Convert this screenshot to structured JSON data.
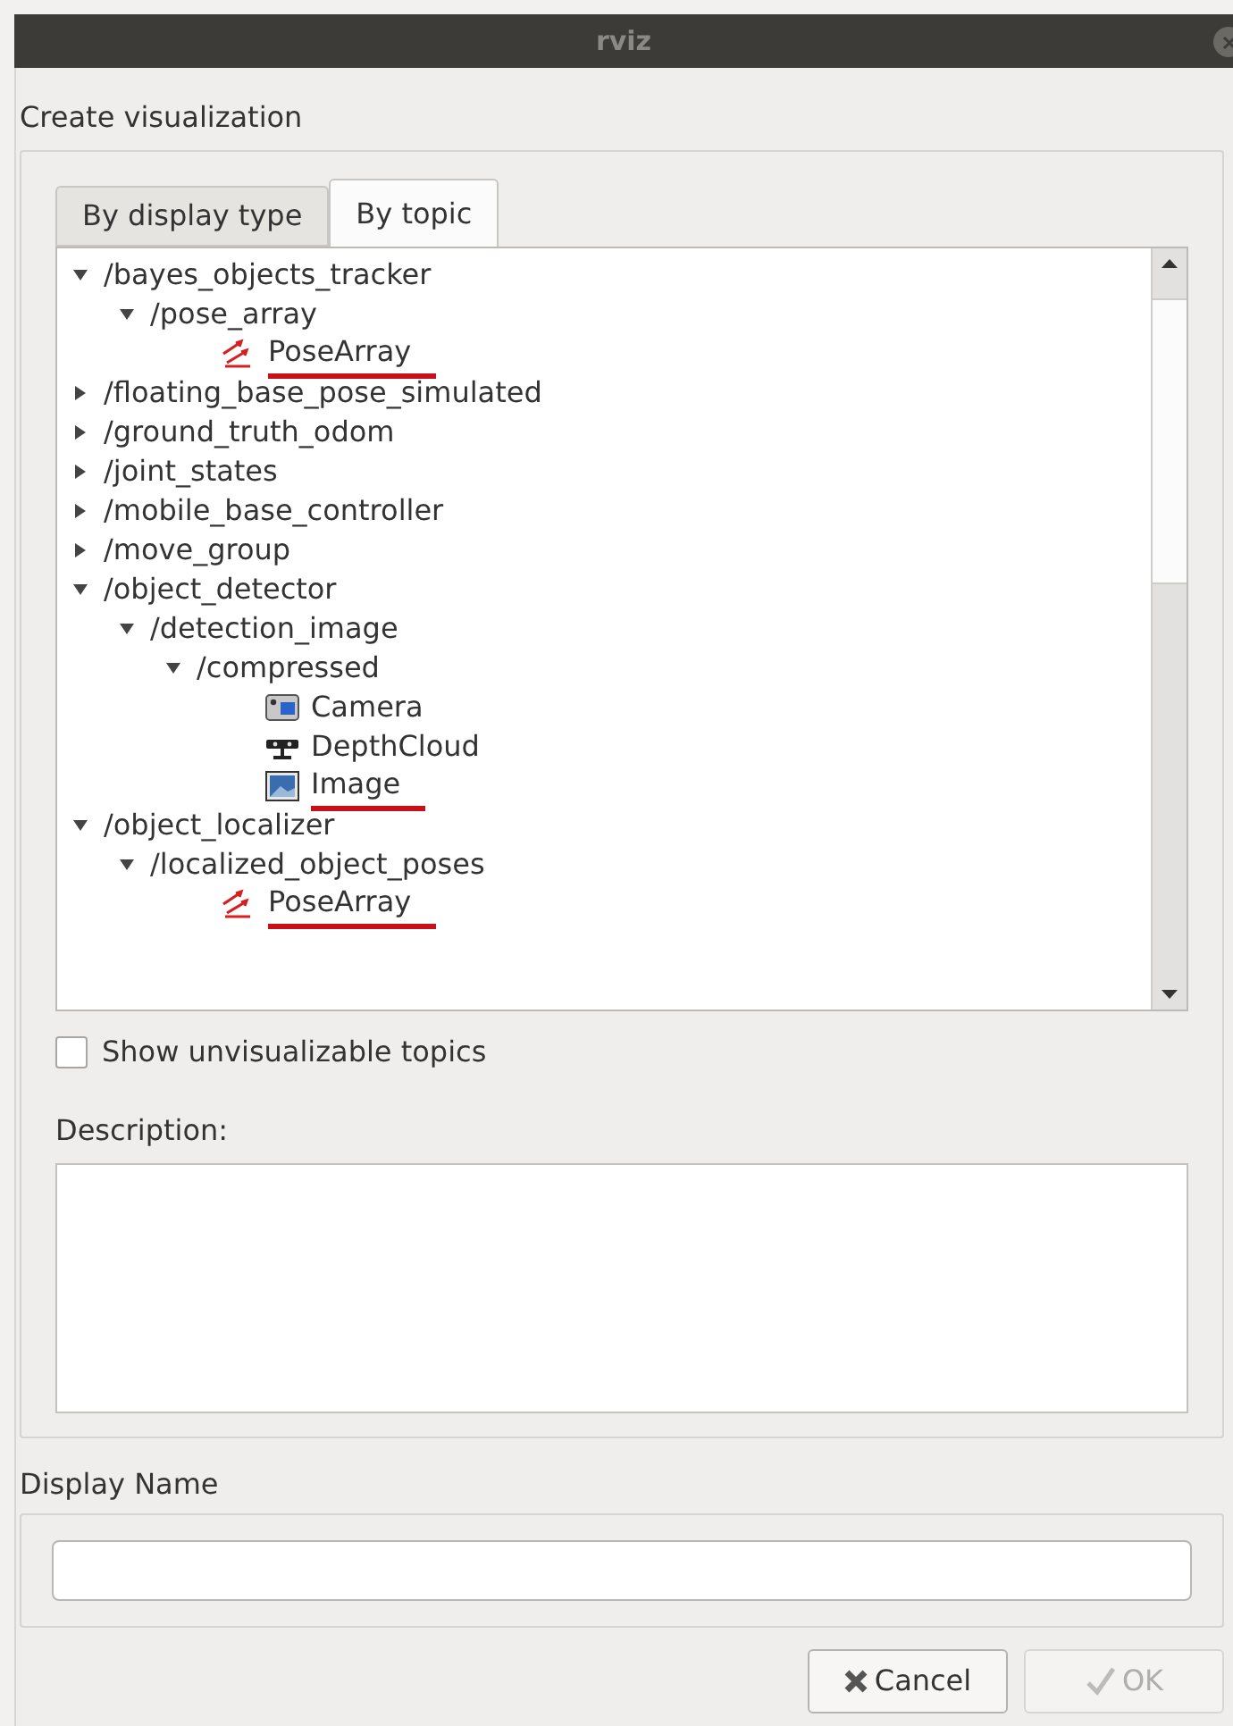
{
  "window": {
    "title": "rviz"
  },
  "heading": "Create visualization",
  "tabs": [
    {
      "label": "By display type",
      "selected": false
    },
    {
      "label": "By topic",
      "selected": true
    }
  ],
  "tree": [
    {
      "kind": "topic",
      "label": "/bayes_objects_tracker",
      "expanded": true,
      "children": [
        {
          "kind": "topic",
          "label": "/pose_array",
          "expanded": true,
          "children": [
            {
              "kind": "posearray",
              "label": "PoseArray",
              "marked": true
            }
          ]
        }
      ]
    },
    {
      "kind": "topic",
      "label": "/floating_base_pose_simulated",
      "expanded": false
    },
    {
      "kind": "topic",
      "label": "/ground_truth_odom",
      "expanded": false
    },
    {
      "kind": "topic",
      "label": "/joint_states",
      "expanded": false
    },
    {
      "kind": "topic",
      "label": "/mobile_base_controller",
      "expanded": false
    },
    {
      "kind": "topic",
      "label": "/move_group",
      "expanded": false
    },
    {
      "kind": "topic",
      "label": "/object_detector",
      "expanded": true,
      "children": [
        {
          "kind": "topic",
          "label": "/detection_image",
          "expanded": true,
          "children": [
            {
              "kind": "topic",
              "label": "/compressed",
              "expanded": true,
              "children": [
                {
                  "kind": "camera",
                  "label": "Camera",
                  "marked": false
                },
                {
                  "kind": "depthcloud",
                  "label": "DepthCloud",
                  "marked": false
                },
                {
                  "kind": "image",
                  "label": "Image",
                  "marked": true
                }
              ]
            }
          ]
        }
      ]
    },
    {
      "kind": "topic",
      "label": "/object_localizer",
      "expanded": true,
      "children": [
        {
          "kind": "topic",
          "label": "/localized_object_poses",
          "expanded": true,
          "children": [
            {
              "kind": "posearray",
              "label": "PoseArray",
              "marked": true
            }
          ]
        }
      ]
    }
  ],
  "show_unvisualizable": {
    "label": "Show unvisualizable topics",
    "checked": false
  },
  "description": {
    "label": "Description:"
  },
  "display_name": {
    "label": "Display Name"
  },
  "buttons": [
    {
      "kind": "cancel",
      "label": "Cancel",
      "disabled": false
    },
    {
      "kind": "ok",
      "label": "OK",
      "disabled": true
    }
  ]
}
